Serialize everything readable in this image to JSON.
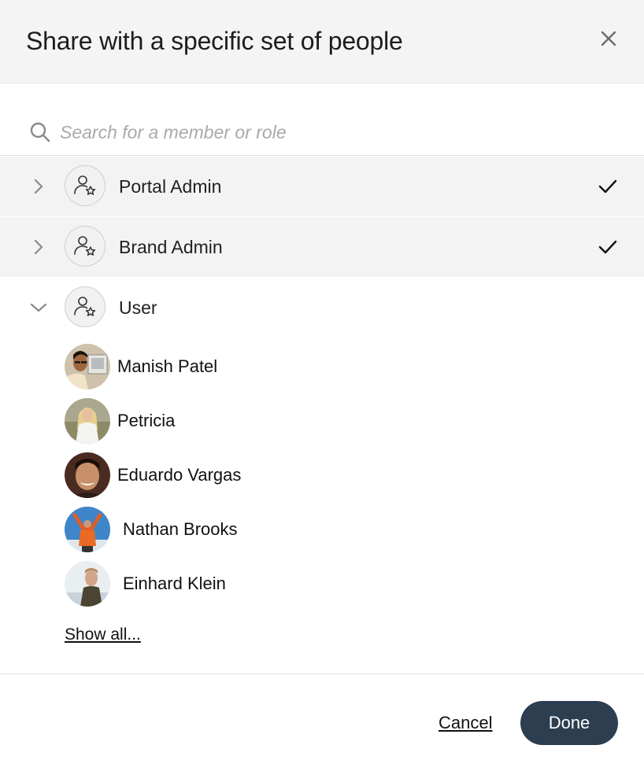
{
  "dialog": {
    "title": "Share with a specific set of people",
    "close_icon": "close-icon"
  },
  "search": {
    "placeholder": "Search for a member or role",
    "value": ""
  },
  "roles": [
    {
      "label": "Portal Admin",
      "expanded": false,
      "selected": true,
      "icon": "user-star-icon"
    },
    {
      "label": "Brand Admin",
      "expanded": false,
      "selected": true,
      "icon": "user-star-icon"
    },
    {
      "label": "User",
      "expanded": true,
      "selected": false,
      "icon": "user-star-icon"
    }
  ],
  "members": [
    {
      "name": "Manish Patel"
    },
    {
      "name": "Petricia"
    },
    {
      "name": "Eduardo Vargas"
    },
    {
      "name": "Nathan Brooks"
    },
    {
      "name": "Einhard Klein"
    }
  ],
  "show_all_label": "Show all...",
  "footer": {
    "cancel_label": "Cancel",
    "done_label": "Done"
  },
  "colors": {
    "header_bg": "#f4f4f4",
    "selected_row_bg": "#f3f3f3",
    "done_button_bg": "#2c3e50"
  }
}
